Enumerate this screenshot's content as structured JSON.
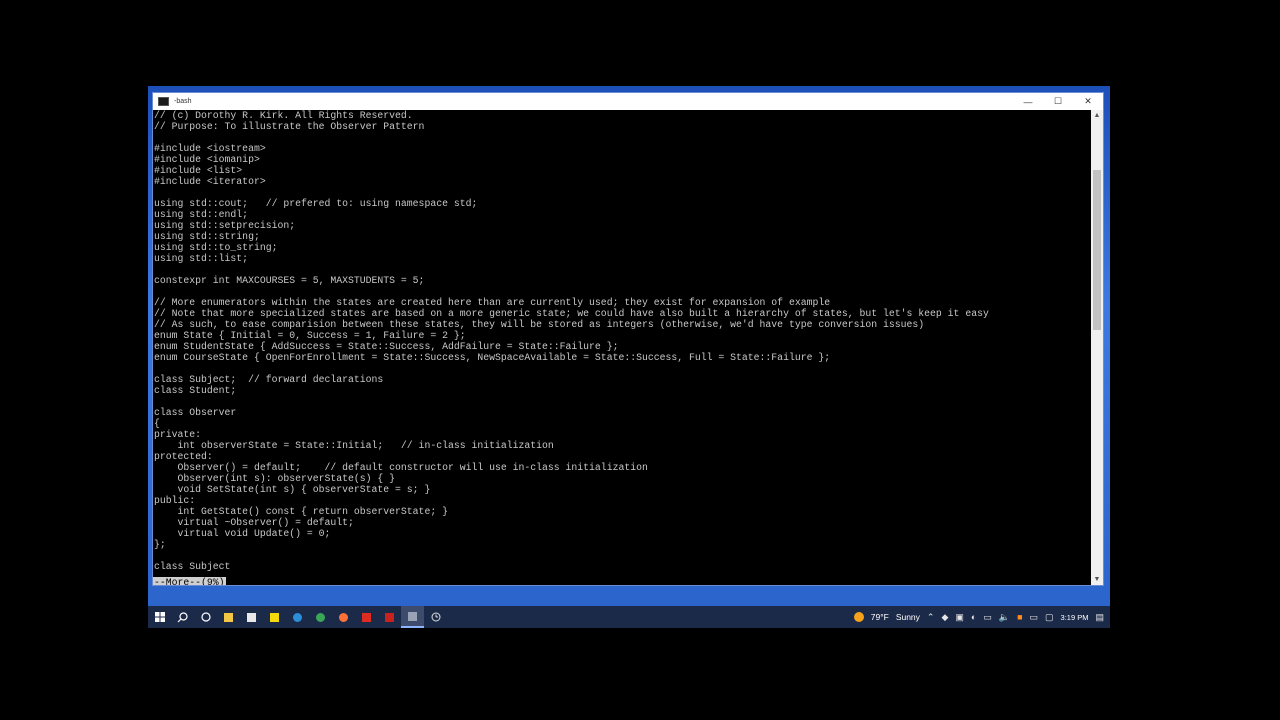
{
  "window": {
    "title": "-bash",
    "controls": {
      "minimize": "—",
      "maximize": "☐",
      "close": "✕"
    }
  },
  "terminal": {
    "lines": [
      "// (c) Dorothy R. Kirk. All Rights Reserved.",
      "// Purpose: To illustrate the Observer Pattern",
      "",
      "#include <iostream>",
      "#include <iomanip>",
      "#include <list>",
      "#include <iterator>",
      "",
      "using std::cout;   // prefered to: using namespace std;",
      "using std::endl;",
      "using std::setprecision;",
      "using std::string;",
      "using std::to_string;",
      "using std::list;",
      "",
      "constexpr int MAXCOURSES = 5, MAXSTUDENTS = 5;",
      "",
      "// More enumerators within the states are created here than are currently used; they exist for expansion of example",
      "// Note that more specialized states are based on a more generic state; we could have also built a hierarchy of states, but let's keep it easy",
      "// As such, to ease comparision between these states, they will be stored as integers (otherwise, we'd have type conversion issues)",
      "enum State { Initial = 0, Success = 1, Failure = 2 };",
      "enum StudentState { AddSuccess = State::Success, AddFailure = State::Failure };",
      "enum CourseState { OpenForEnrollment = State::Success, NewSpaceAvailable = State::Success, Full = State::Failure };",
      "",
      "class Subject;  // forward declarations",
      "class Student;",
      "",
      "class Observer",
      "{",
      "private:",
      "    int observerState = State::Initial;   // in-class initialization",
      "protected:",
      "    Observer() = default;    // default constructor will use in-class initialization",
      "    Observer(int s): observerState(s) { }",
      "    void SetState(int s) { observerState = s; }",
      "public:",
      "    int GetState() const { return observerState; }",
      "    virtual ~Observer() = default;",
      "    virtual void Update() = 0;",
      "};",
      "",
      "class Subject"
    ],
    "pager_prompt": "--More--(9%)"
  },
  "taskbar": {
    "weather_temp": "79°F",
    "weather_desc": "Sunny",
    "time": "3:19 PM",
    "colors": {
      "bar": "#1c2a4a",
      "sun": "#f6a21a"
    }
  }
}
